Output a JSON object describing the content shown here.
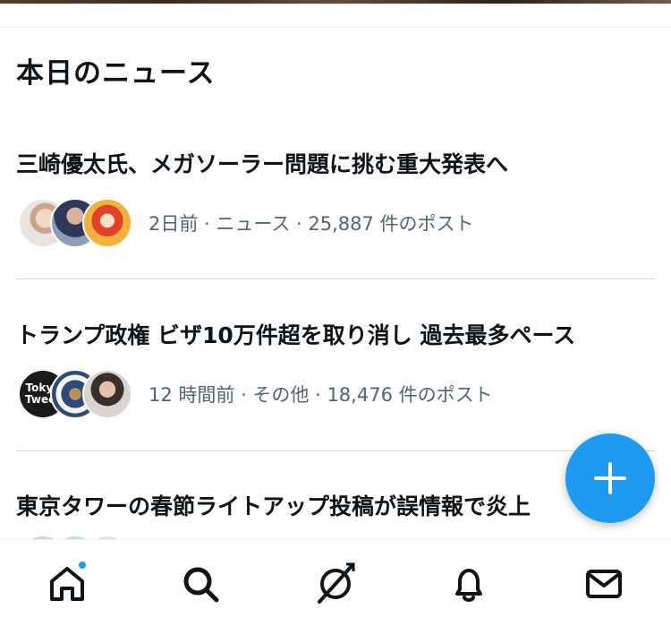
{
  "section": {
    "title": "本日のニュース"
  },
  "news": [
    {
      "headline": "三崎優太氏、メガソーラー問題に挑む重大発表へ",
      "meta": "2日前 · ニュース · 25,887 件のポスト",
      "avatars": [
        "photo-avatar",
        "photo-avatar",
        "illustration-avatar"
      ]
    },
    {
      "headline": "トランプ政権 ビザ10万件超を取り消し 過去最多ペース",
      "meta": "12 時間前 · その他 · 18,476 件のポスト",
      "avatars": [
        "tokyo-tweet-avatar",
        "seal-avatar",
        "photo-avatar"
      ],
      "avatar_text": [
        "Tokyo",
        "Tweet"
      ]
    },
    {
      "headline": "東京タワーの春節ライトアップ投稿が誤情報で炎上",
      "meta": "",
      "avatars": [
        "photo-avatar",
        "photo-avatar",
        "photo-avatar"
      ]
    }
  ],
  "fab": {
    "icon": "plus-icon"
  },
  "nav": {
    "items": [
      {
        "name": "home",
        "icon": "home-icon",
        "has_badge": true
      },
      {
        "name": "search",
        "icon": "search-icon"
      },
      {
        "name": "grok",
        "icon": "grok-icon"
      },
      {
        "name": "notifications",
        "icon": "bell-icon"
      },
      {
        "name": "messages",
        "icon": "mail-icon"
      }
    ]
  },
  "colors": {
    "accent": "#1d9bf0",
    "text": "#0f1419",
    "secondary": "#536471"
  }
}
